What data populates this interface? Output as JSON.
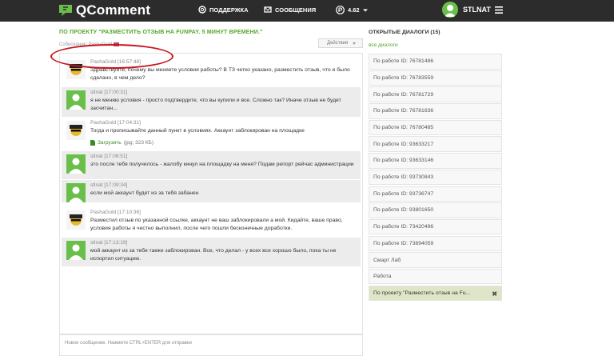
{
  "header": {
    "logo": "QComment",
    "support": "ПОДДЕРЖКА",
    "messages": "СООБЩЕНИЯ",
    "balance": "4.62",
    "username": "STLNAT"
  },
  "project": {
    "title": "ПО ПРОЕКТУ \"РАЗМЕСТИТЬ ОТЗЫВ НА FUNPAY. 5 МИНУТ ВРЕМЕНИ.\"",
    "interlocutor_label": "Собеседник: PashaGold",
    "actions_label": "Действия"
  },
  "messages": [
    {
      "author": "PashaGold",
      "time": "[16:57:48]",
      "text": "Здравствуйте, почему вы меняете условия работы? В ТЗ четко указано, разместить отзыв, что и было сделано, в чем дело?"
    },
    {
      "author": "stlnat",
      "time": "[17:00:31]",
      "text": "я не меняю условия - просто подтвердите, что вы купили и все. Сложно так? Иначе отзыв не будет засчитан..."
    },
    {
      "author": "PashaGold",
      "time": "[17:04:31]",
      "text": "Тогда и прописывайте данный пункт в условиях. Аккаунт заблокирован на площадке",
      "attach_link": "Загрузить",
      "attach_size": "(jpg; 323 КБ)"
    },
    {
      "author": "stlnat",
      "time": "[17:06:51]",
      "text": "это после тебя получилось - жалобу кинул на площадку на меня? Подам репорт рейчас администрации"
    },
    {
      "author": "stlnat",
      "time": "[17:09:34]",
      "text": "если мой аккаунт будет из за тебя забанен"
    },
    {
      "author": "PashaGold",
      "time": "[17:10:36]",
      "text": "Разместил отзыв по указанной ссылке, аккаунт не ваш заблокировали а мой. Кидайте, ваше право, условия работы я честно выполнил, после чего пошли бесконечные доработки."
    },
    {
      "author": "stlnat",
      "time": "[17:13:19]",
      "text": "мой аккаунт из за тебя также заблокирован. Все, что делал - у всех все хорошо было, пока ты не испортил ситуацию."
    }
  ],
  "composer": {
    "placeholder": "Новое сообщение. Нажмите CTRL+ENTER для отправки"
  },
  "sidebar": {
    "title": "ОТКРЫТЫЕ ДИАЛОГИ (15)",
    "all_dialogs": "все диалоги",
    "items": [
      "По работе ID: 76781486",
      "По работе ID: 76783559",
      "По работе ID: 76781729",
      "По работе ID: 76781636",
      "По работе ID: 76780485",
      "По работе ID: 93633217",
      "По работе ID: 93633146",
      "По работе ID: 93730843",
      "По работе ID: 93736747",
      "По работе ID: 93801650",
      "По работе ID: 73420496",
      "По работе ID: 73894059",
      "Смарт Лаб",
      "Работа",
      "По проекту \"Разместить отзыв на Fu..."
    ],
    "close_glyph": "✖"
  },
  "colors": {
    "accent": "#52a824",
    "topbar": "#2c2c2c",
    "annotation": "#c8141e"
  }
}
